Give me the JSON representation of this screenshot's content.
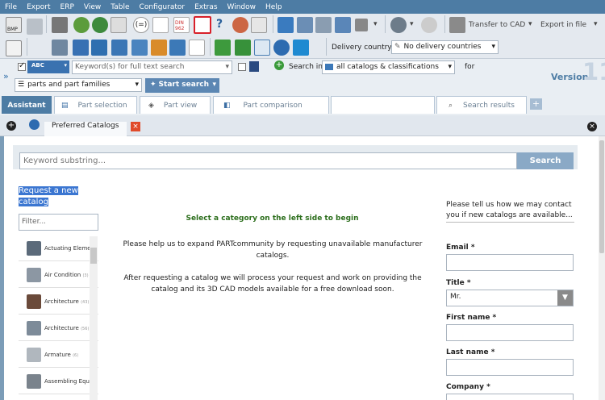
{
  "menu": [
    "File",
    "Export",
    "ERP",
    "View",
    "Table",
    "Configurator",
    "Extras",
    "Window",
    "Help"
  ],
  "toolbar": {
    "bmp_label": "BMP",
    "din_label": "DIN 962",
    "transfer_cad": "Transfer to CAD",
    "export_file": "Export in file",
    "delivery_label": "Delivery country:",
    "delivery_value": "No delivery countries"
  },
  "search": {
    "abc_label": "ABC",
    "keyword_placeholder": "Keyword(s) for full text search",
    "search_in_label": "Search in",
    "search_in_value": "all catalogs & classifications",
    "for_label": "for",
    "parts_value": "parts and part families",
    "start_search": "Start search"
  },
  "version": {
    "label": "Version",
    "number": "11"
  },
  "tabs": [
    "Assistant",
    "Part selection",
    "Part view",
    "Part comparison",
    "",
    "Search results"
  ],
  "panel": {
    "title": "Preferred Catalogs"
  },
  "content": {
    "keyword_placeholder": "Keyword substring...",
    "search_button": "Search",
    "request_link": "Request a new catalog",
    "filter_placeholder": "Filter...",
    "categories": [
      {
        "name": "Actuating Eleme",
        "count": ""
      },
      {
        "name": "Air Condition",
        "count": "(3)"
      },
      {
        "name": "Architecture",
        "count": "(43)"
      },
      {
        "name": "Architecture",
        "count": "(56)"
      },
      {
        "name": "Armature",
        "count": "(6)"
      },
      {
        "name": "Assembling Equ",
        "count": ""
      }
    ],
    "select_category": "Select a category on the left side to begin",
    "help_text": "Please help us to expand PARTcommunity by requesting unavailable manufacturer catalogs.",
    "after_text": "After requesting a catalog we will process your request and work on providing the catalog and its 3D CAD models available for a free download soon."
  },
  "form": {
    "intro": "Please tell us how we may contact you if new catalogs are available...",
    "email_label": "Email *",
    "title_label": "Title *",
    "title_value": "Mr.",
    "first_name_label": "First name *",
    "last_name_label": "Last name *",
    "company_label": "Company *"
  }
}
